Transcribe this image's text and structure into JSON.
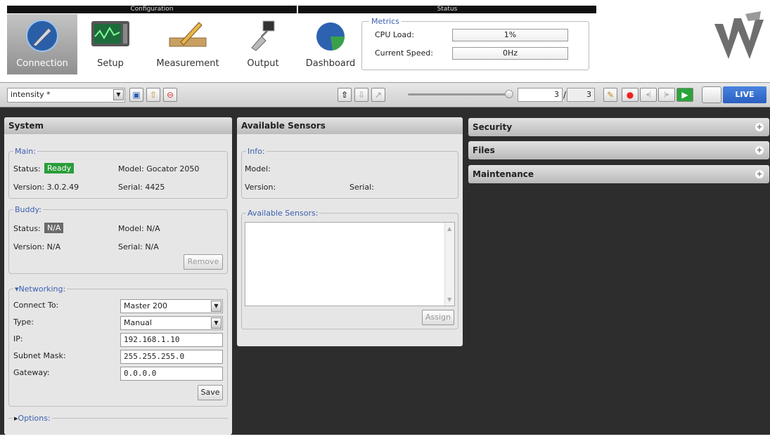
{
  "top": {
    "group_configuration": "Configuration",
    "group_status": "Status",
    "nav": {
      "connection": "Connection",
      "setup": "Setup",
      "measurement": "Measurement",
      "output": "Output",
      "dashboard": "Dashboard"
    },
    "metrics": {
      "title": "Metrics",
      "cpu_label": "CPU Load:",
      "cpu_value": "1%",
      "speed_label": "Current Speed:",
      "speed_value": "0Hz"
    }
  },
  "toolbar": {
    "job_name": "intensity *",
    "frame_current": "3",
    "frame_total": "3",
    "live_label": "LIVE"
  },
  "system": {
    "title": "System",
    "main": {
      "title": "Main:",
      "status_label": "Status:",
      "status_value": "Ready",
      "model_label": "Model: Gocator 2050",
      "version_label": "Version: 3.0.2.49",
      "serial_label": "Serial: 4425"
    },
    "buddy": {
      "title": "Buddy:",
      "status_label": "Status:",
      "status_value": "N/A",
      "model_label": "Model: N/A",
      "version_label": "Version: N/A",
      "serial_label": "Serial: N/A",
      "remove_label": "Remove"
    },
    "networking": {
      "title": "Networking:",
      "connect_to_label": "Connect To:",
      "connect_to_value": "Master 200",
      "type_label": "Type:",
      "type_value": "Manual",
      "ip_label": "IP:",
      "ip_value": "192.168.1.10",
      "subnet_label": "Subnet Mask:",
      "subnet_value": "255.255.255.0",
      "gateway_label": "Gateway:",
      "gateway_value": "0.0.0.0",
      "save_label": "Save"
    },
    "options": {
      "title": "Options:"
    }
  },
  "sensors": {
    "title": "Available Sensors",
    "info": {
      "title": "Info:",
      "model_label": "Model:",
      "version_label": "Version:",
      "serial_label": "Serial:"
    },
    "list": {
      "title": "Available Sensors:",
      "assign_label": "Assign"
    }
  },
  "accordion": {
    "security": "Security",
    "files": "Files",
    "maintenance": "Maintenance"
  },
  "colors": {
    "ready_badge": "#2a9d3a",
    "na_badge": "#6a6a6a",
    "live_button": "#2f66c9",
    "group_label": "#3a5fb0",
    "workspace_bg": "#2d2d2d"
  }
}
